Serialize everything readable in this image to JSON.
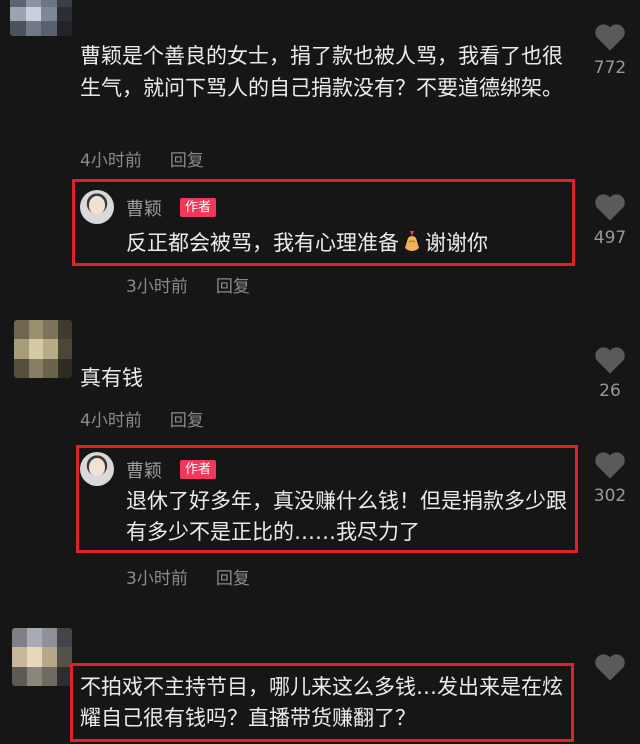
{
  "comments": [
    {
      "text": "曹颖是个善良的女士，捐了款也被人骂，我看了也很生气，就问下骂人的自己捐款没有？不要道德绑架。",
      "time": "4小时前",
      "reply_label": "回复",
      "likes": "772",
      "author_reply": {
        "name": "曹颖",
        "badge": "作者",
        "text_before": "反正都会被骂，我有心理准备",
        "emoji_icon": "medal-icon",
        "text_after": "谢谢你",
        "time": "3小时前",
        "reply_label": "回复",
        "likes": "497"
      }
    },
    {
      "text": "真有钱",
      "time": "4小时前",
      "reply_label": "回复",
      "likes": "26",
      "author_reply": {
        "name": "曹颖",
        "badge": "作者",
        "text": "退休了好多年，真没赚什么钱！但是捐款多少跟有多少不是正比的……我尽力了",
        "time": "3小时前",
        "reply_label": "回复",
        "likes": "302"
      }
    },
    {
      "text": "不拍戏不主持节目，哪儿来这么多钱…发出来是在炫耀自己很有钱吗？直播带货赚翻了？"
    }
  ],
  "colors": {
    "background": "#161616",
    "highlight_box": "#e0202a",
    "author_badge": "#f23759",
    "meta_text": "#8a8a8a"
  }
}
